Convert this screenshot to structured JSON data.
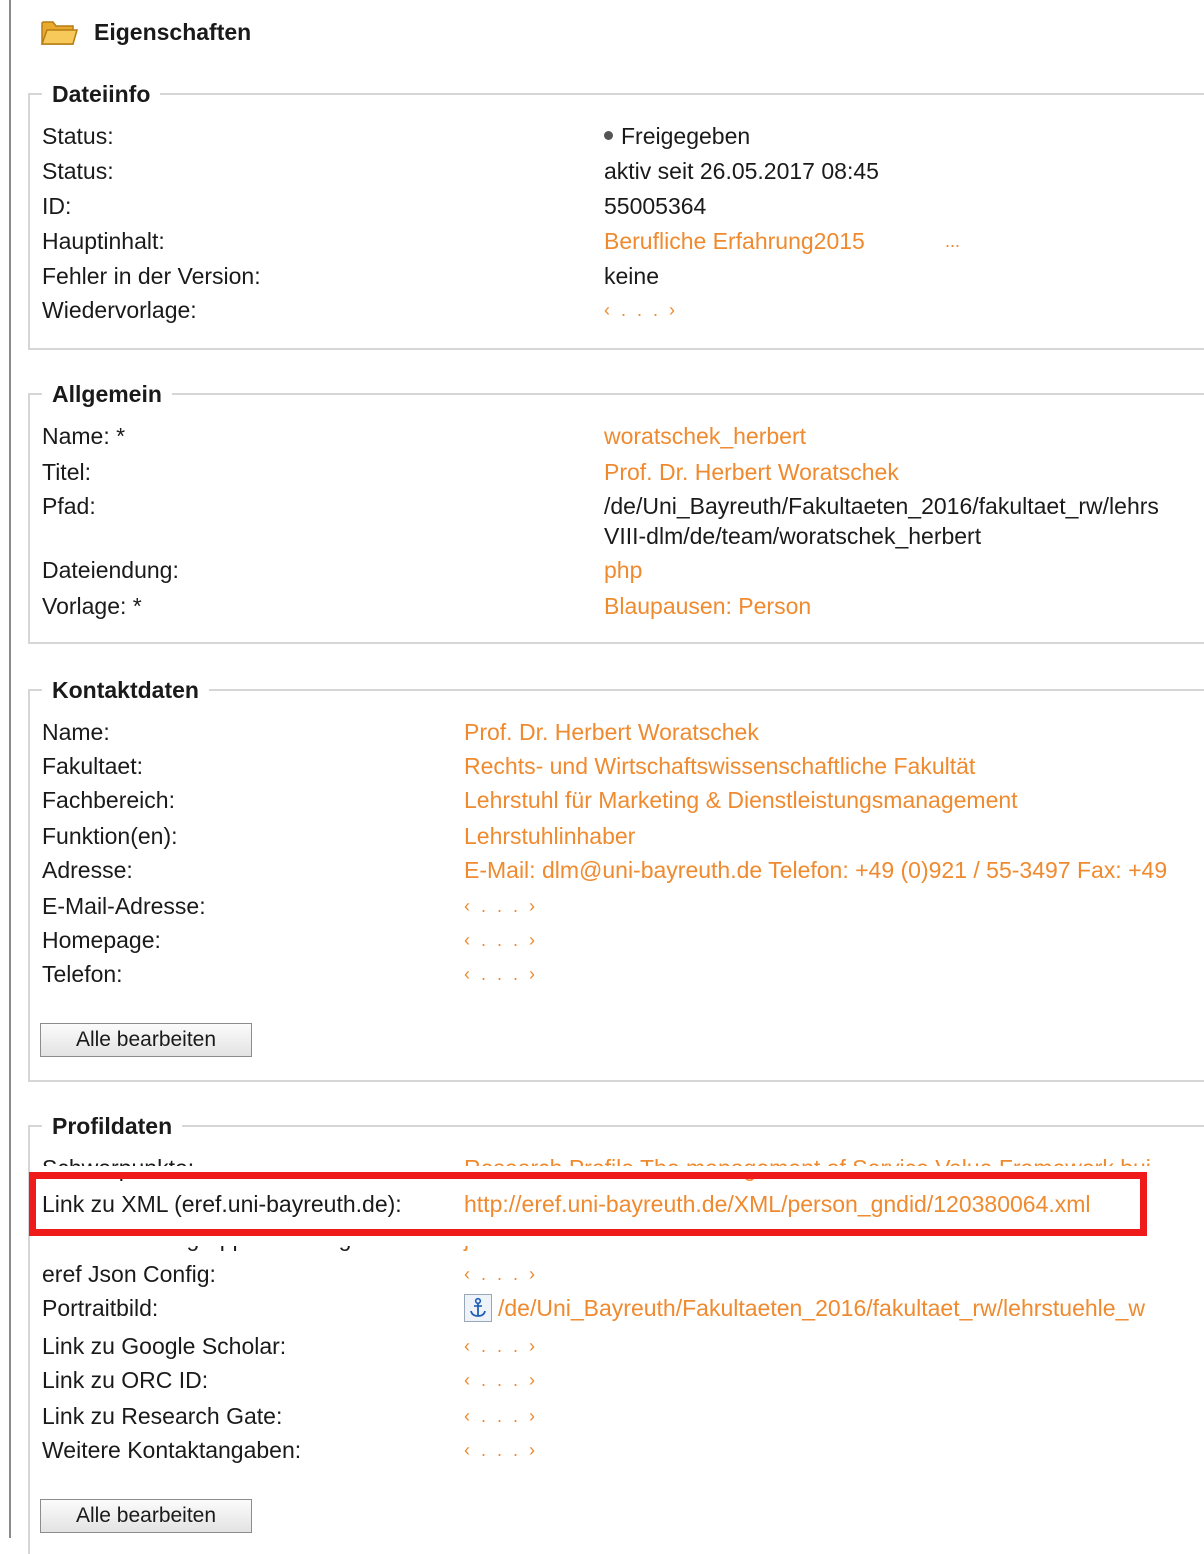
{
  "header": {
    "title": "Eigenschaften",
    "icon": "folder-icon"
  },
  "dateiinfo": {
    "legend": "Dateiinfo",
    "status_label": "Status:",
    "status_value": "Freigegeben",
    "status2_label": "Status:",
    "status2_value": "aktiv seit 26.05.2017 08:45",
    "id_label": "ID:",
    "id_value": "55005364",
    "hauptinhalt_label": "Hauptinhalt:",
    "hauptinhalt_value": "Berufliche Erfahrung2015",
    "hauptinhalt_more": "...",
    "fehler_label": "Fehler in der Version:",
    "fehler_value": "keine",
    "wiedervorlage_label": "Wiedervorlage:",
    "wiedervorlage_value": "‹ . . . ›"
  },
  "allgemein": {
    "legend": "Allgemein",
    "name_label": "Name: *",
    "name_value": "woratschek_herbert",
    "titel_label": "Titel:",
    "titel_value": "Prof. Dr. Herbert Woratschek",
    "pfad_label": "Pfad:",
    "pfad_value_line1": "/de/Uni_Bayreuth/Fakultaeten_2016/fakultaet_rw/lehrs",
    "pfad_value_line2": "VIII-dlm/de/team/woratschek_herbert",
    "dateiendung_label": "Dateiendung:",
    "dateiendung_value": "php",
    "vorlage_label": "Vorlage: *",
    "vorlage_value": "Blaupausen: Person"
  },
  "kontaktdaten": {
    "legend": "Kontaktdaten",
    "name_label": "Name:",
    "name_value": "Prof. Dr. Herbert Woratschek",
    "fakultaet_label": "Fakultaet:",
    "fakultaet_value": "Rechts- und Wirtschaftswissenschaftliche Fakultät",
    "fachbereich_label": "Fachbereich:",
    "fachbereich_value": "Lehrstuhl für Marketing & Dienstleistungsmanagement",
    "funktion_label": "Funktion(en):",
    "funktion_value": "Lehrstuhlinhaber",
    "adresse_label": "Adresse:",
    "adresse_value": "E-Mail: dlm@uni-bayreuth.de Telefon: +49 (0)921 / 55-3497 Fax: +49",
    "email_label": "E-Mail-Adresse:",
    "email_value": "‹ . . . ›",
    "homepage_label": "Homepage:",
    "homepage_value": "‹ . . . ›",
    "telefon_label": "Telefon:",
    "telefon_value": "‹ . . . ›",
    "edit_button": "Alle bearbeiten"
  },
  "profildaten": {
    "legend": "Profildaten",
    "schwerpunkte_label": "Schwerpunkte:",
    "schwerpunkte_value": "Research Profile The management of Service Value Framework bui",
    "xml_label": "Link zu XML (eref.uni-bayreuth.de):",
    "xml_value": "http://eref.uni-bayreuth.de/XML/person_gndid/120380064.xml",
    "publikationen_label": "Publikationen gruppiert anzeigen?:",
    "publikationen_value": "ja",
    "eref_label": "eref Json Config:",
    "eref_value": "‹ . . . ›",
    "portrait_label": "Portraitbild:",
    "portrait_value": "/de/Uni_Bayreuth/Fakultaeten_2016/fakultaet_rw/lehrstuehle_w",
    "scholar_label": "Link zu Google Scholar:",
    "scholar_value": "‹ . . . ›",
    "orcid_label": "Link zu ORC ID:",
    "orcid_value": "‹ . . . ›",
    "researchgate_label": "Link zu Research Gate:",
    "researchgate_value": "‹ . . . ›",
    "weitere_label": "Weitere Kontaktangaben:",
    "weitere_value": "‹ . . . ›",
    "edit_button": "Alle bearbeiten"
  },
  "colors": {
    "link": "#ef8a2f",
    "highlight": "#ef1a1a",
    "border": "#d6d6d6"
  }
}
